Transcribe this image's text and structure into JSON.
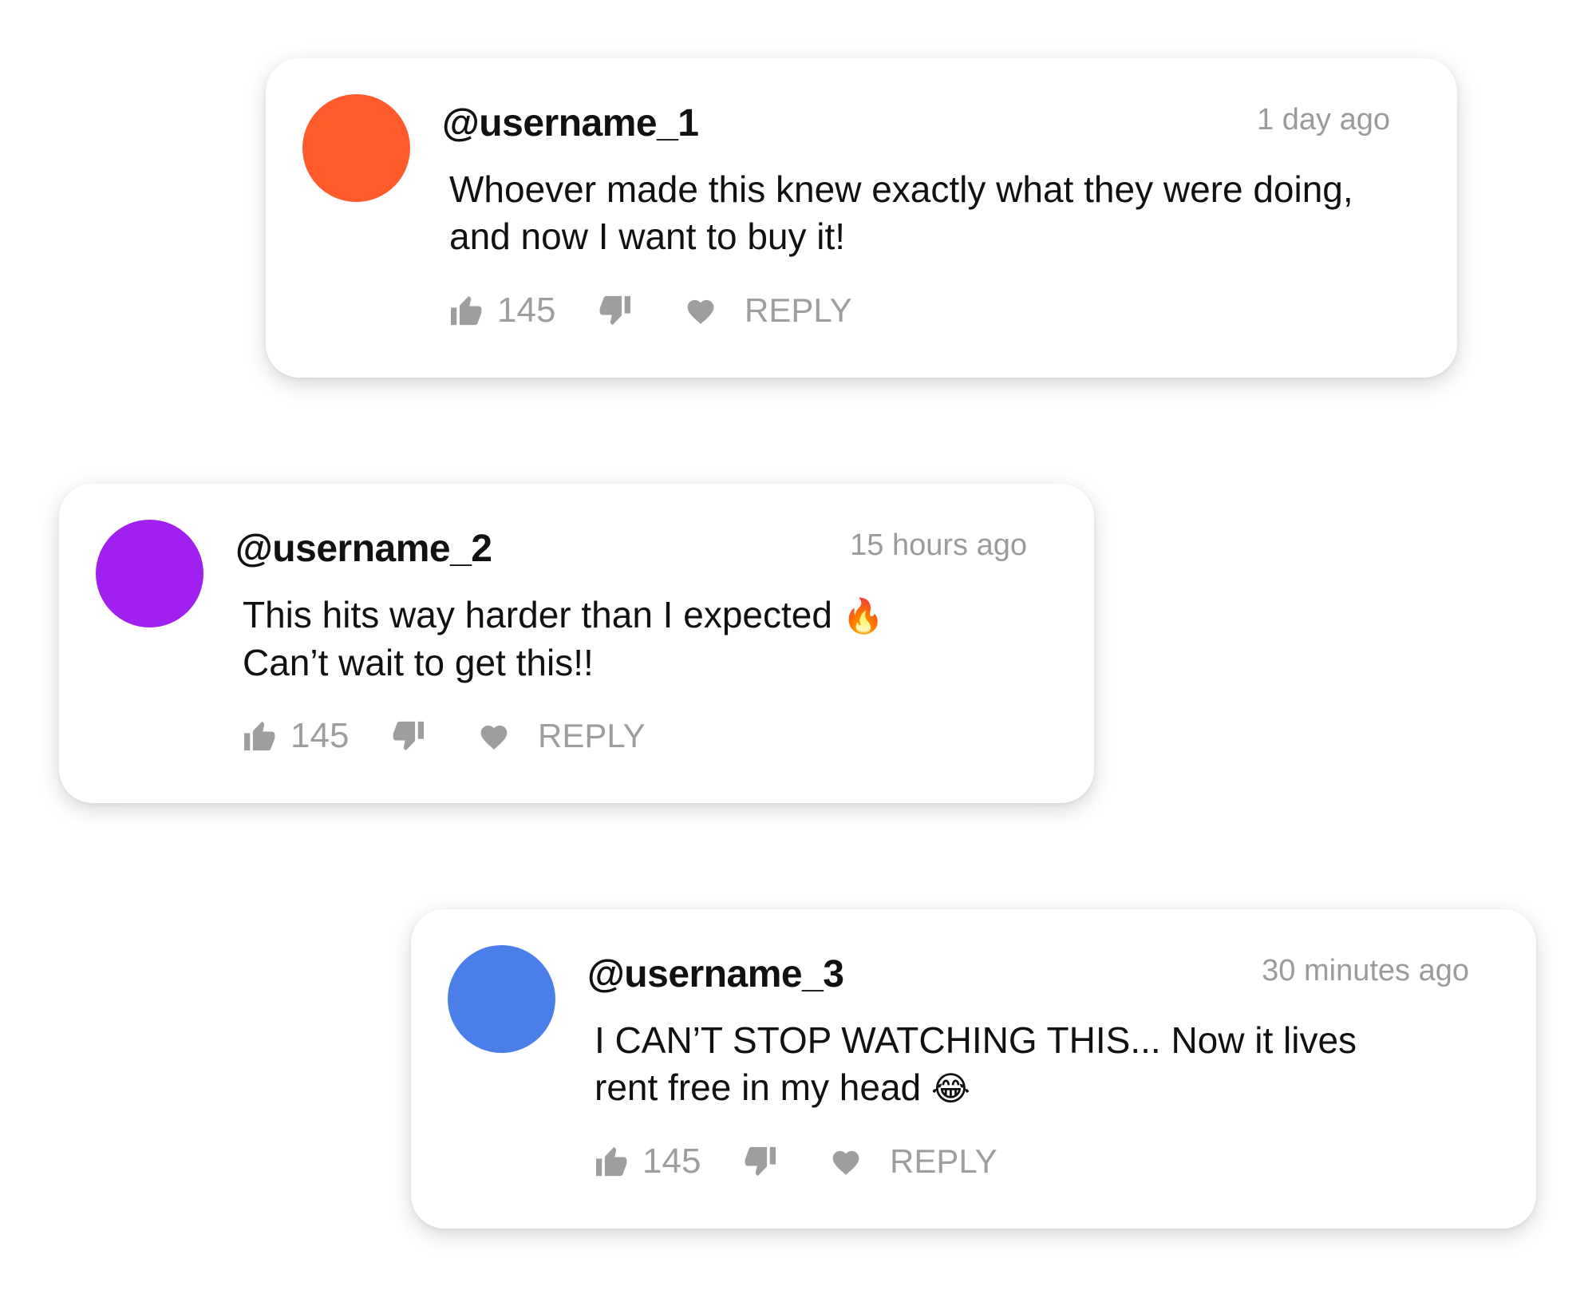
{
  "comments": [
    {
      "username": "@username_1",
      "time": "1 day ago",
      "text": "Whoever made this knew exactly what they were doing,\nand now I want to buy it!",
      "emoji": "",
      "likes": "145",
      "reply_label": "REPLY",
      "avatar_color": "#FF5A2C"
    },
    {
      "username": "@username_2",
      "time": "15 hours ago",
      "text": "This hits way harder than I expected ",
      "emoji": "🔥",
      "text_after": "\nCan’t wait to get this!!",
      "likes": "145",
      "reply_label": "REPLY",
      "avatar_color": "#A020F0"
    },
    {
      "username": "@username_3",
      "time": "30 minutes ago",
      "text": "I CAN’T STOP WATCHING THIS... Now it lives\nrent free in my head ",
      "emoji": "😂",
      "likes": "145",
      "reply_label": "REPLY",
      "avatar_color": "#4A7FEA"
    }
  ],
  "icons": {
    "like": "thumbs-up-icon",
    "dislike": "thumbs-down-icon",
    "heart": "heart-icon"
  },
  "colors": {
    "muted": "#9e9e9e",
    "text": "#111111",
    "background": "#ffffff"
  }
}
